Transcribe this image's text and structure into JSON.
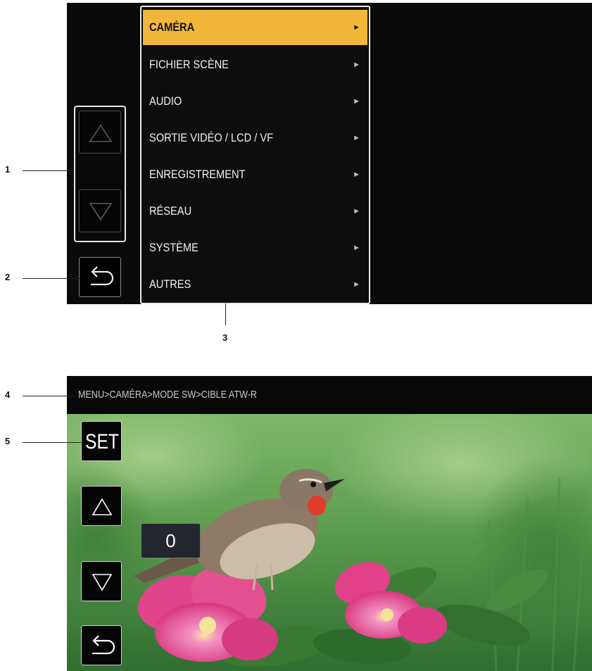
{
  "callouts": {
    "c1": "1",
    "c2": "2",
    "c3": "3",
    "c4": "4",
    "c5": "5"
  },
  "menu": {
    "items": [
      {
        "label": "CAMÉRA",
        "arrow": "►",
        "selected": true
      },
      {
        "label": "FICHIER SCÈNE",
        "arrow": "►"
      },
      {
        "label": "AUDIO",
        "arrow": "►"
      },
      {
        "label": "SORTIE VIDÉO / LCD / VF",
        "arrow": "►"
      },
      {
        "label": "ENREGISTREMENT",
        "arrow": "►"
      },
      {
        "label": "RÉSEAU",
        "arrow": "►"
      },
      {
        "label": "SYSTÈME",
        "arrow": "►"
      },
      {
        "label": "AUTRES",
        "arrow": "►"
      }
    ],
    "highlight_color": "#f0b73a",
    "icons": {
      "up": "triangle-up-icon",
      "down": "triangle-down-icon",
      "back": "return-arrow-icon"
    }
  },
  "edit": {
    "breadcrumb": "MENU>CAMÉRA>MODE SW>CIBLE ATW-R",
    "set_label": "SET",
    "value": "0",
    "icons": {
      "up": "triangle-up-icon",
      "down": "triangle-down-icon",
      "back": "return-arrow-icon"
    }
  }
}
